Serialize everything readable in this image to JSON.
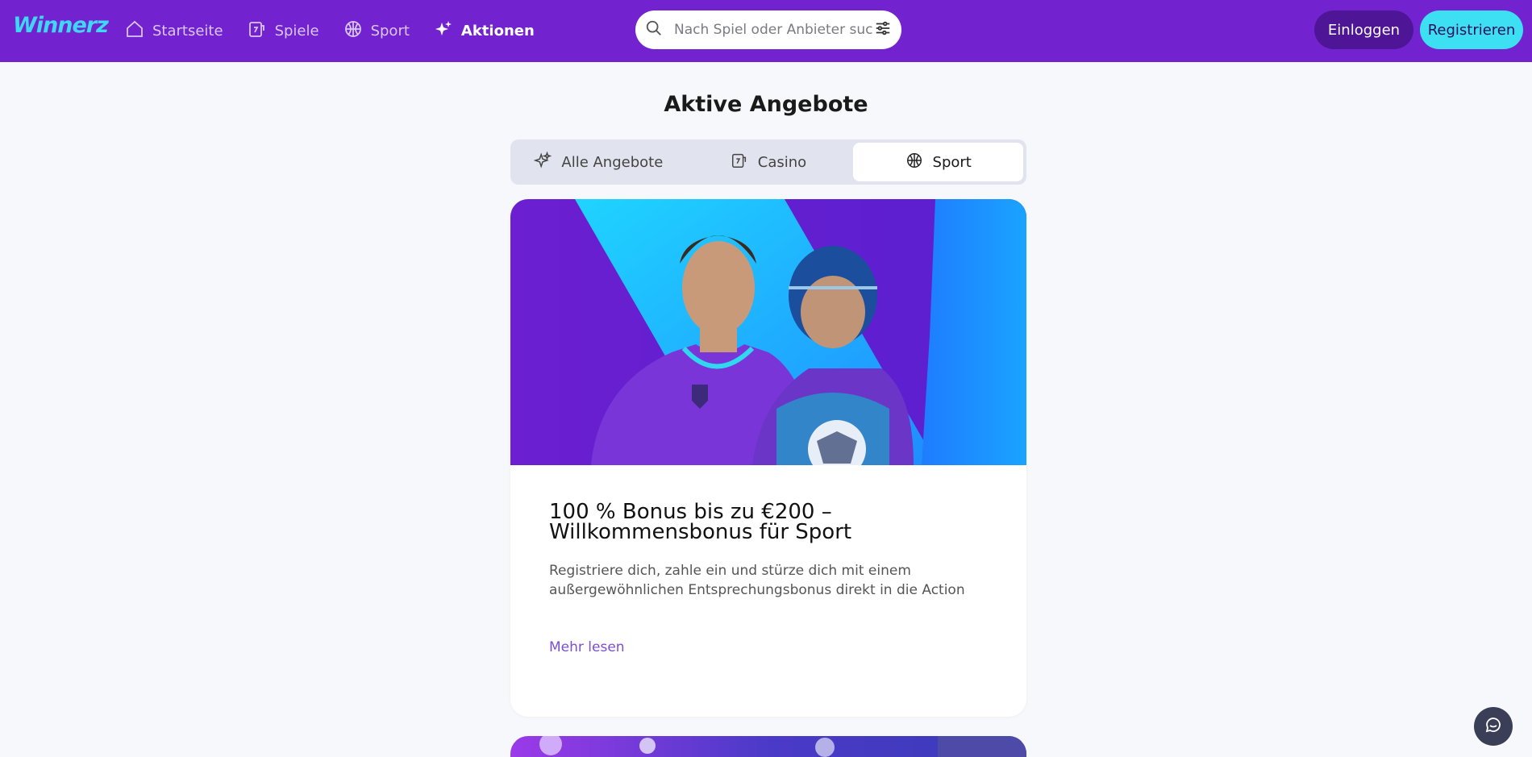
{
  "header": {
    "logo_text": "Winnerz",
    "nav": [
      {
        "label": "Startseite",
        "icon": "home-icon"
      },
      {
        "label": "Spiele",
        "icon": "slot-machine-icon"
      },
      {
        "label": "Sport",
        "icon": "ball-icon"
      },
      {
        "label": "Aktionen",
        "icon": "sparkles-icon",
        "active": true
      }
    ],
    "search": {
      "placeholder": "Nach Spiel oder Anbieter suchen",
      "value": ""
    },
    "login_label": "Einloggen",
    "register_label": "Registrieren"
  },
  "main": {
    "title": "Aktive Angebote",
    "tabs": [
      {
        "label": "Alle Angebote",
        "icon": "sparkles-icon"
      },
      {
        "label": "Casino",
        "icon": "slot-machine-icon"
      },
      {
        "label": "Sport",
        "icon": "ball-icon",
        "active": true
      }
    ],
    "offers": [
      {
        "title": "100 % Bonus bis zu €200 – Willkommensbonus für Sport",
        "description": "Registriere dich, zahle ein und stürze dich mit einem außergewöhnlichen Entsprechungsbonus direkt in die Action",
        "link_label": "Mehr lesen"
      }
    ]
  },
  "colors": {
    "header_bg": "#7322cf",
    "accent_cyan": "#3de0f2",
    "login_bg": "#4e1597",
    "link": "#7b4fd0"
  }
}
